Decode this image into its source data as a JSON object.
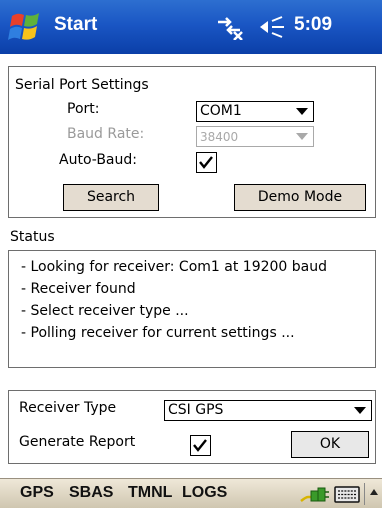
{
  "titlebar": {
    "start_label": "Start",
    "clock": "5:09",
    "icons": [
      "windows-flag-icon",
      "network-icon",
      "volume-icon"
    ]
  },
  "serial_port": {
    "heading": "Serial Port Settings",
    "port_label": "Port:",
    "port_value": "COM1",
    "baud_label": "Baud Rate:",
    "baud_value": "38400",
    "auto_baud_label": "Auto-Baud:",
    "auto_baud_checked": true,
    "search_button": "Search",
    "demo_button": "Demo Mode"
  },
  "status": {
    "heading": "Status",
    "lines": [
      "- Looking for receiver: Com1 at 19200 baud",
      "- Receiver found",
      "- Select receiver type ...",
      "- Polling receiver for current settings ..."
    ]
  },
  "receiver": {
    "type_label": "Receiver Type",
    "type_value": "CSI GPS",
    "report_label": "Generate Report",
    "report_checked": true,
    "ok_button": "OK"
  },
  "menubar": {
    "items": [
      "GPS",
      "SBAS",
      "TMNL",
      "LOGS"
    ],
    "icons": [
      "connection-plug-icon",
      "keyboard-icon",
      "sip-arrow-icon"
    ]
  },
  "colors": {
    "titlebar": "#1a56c4",
    "button_face": "#e4dcd0",
    "menubar": "#e3dccb"
  }
}
